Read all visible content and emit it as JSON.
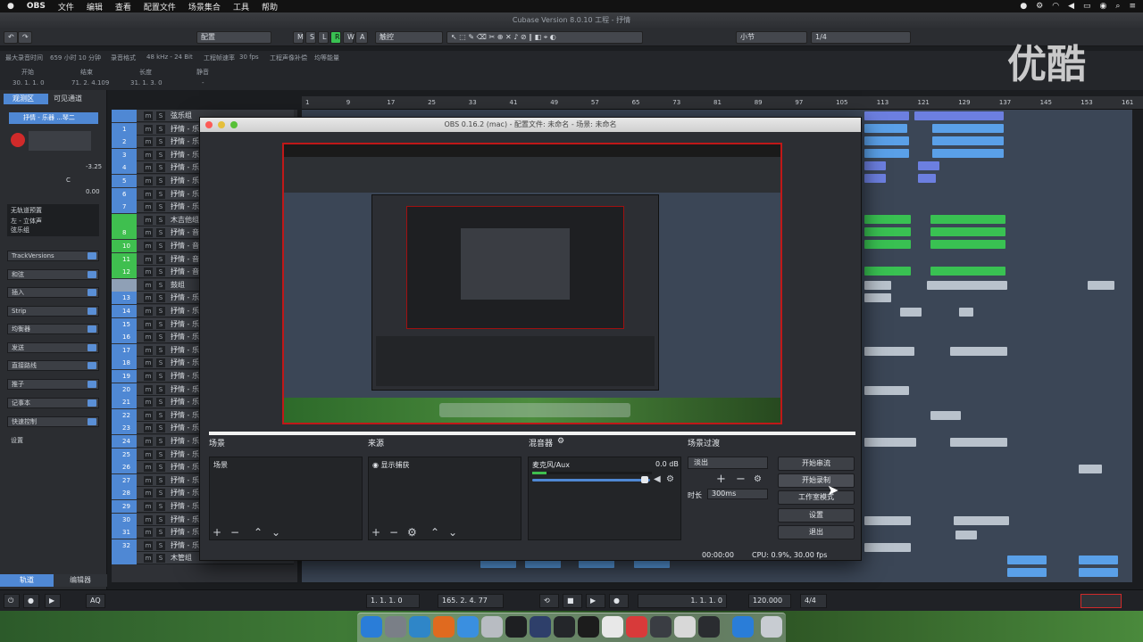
{
  "menubar": {
    "app": "OBS",
    "items": [
      "文件",
      "编辑",
      "查看",
      "配置文件",
      "场景集合",
      "工具",
      "帮助"
    ]
  },
  "cubase": {
    "title": "Cubase Version 8.0.10 工程 - 抒情",
    "toolbar": {
      "preset": "配置",
      "m": "M",
      "s": "S",
      "l": "L",
      "r": "R",
      "w": "W",
      "a": "A",
      "snap": "触控",
      "quant": "小节",
      "ratio": "1/4"
    },
    "info": [
      "最大录音时间",
      "659 小时 10 分钟",
      "录音格式",
      "48 kHz - 24 Bit",
      "工程帧速率",
      "30 fps",
      "工程声像补偿",
      "均等能量"
    ],
    "ruler_labels": [
      "开始",
      "结束",
      "长度",
      "静音"
    ],
    "ruler_values": [
      "30. 1. 1. 0",
      "71. 2. 4.109",
      "31. 1. 3. 0",
      "-"
    ]
  },
  "inspector": {
    "tabs": [
      "观测区",
      "可见通道"
    ],
    "track_name": "抒情 - 乐器 ...琴二",
    "level": "-3.25",
    "pan": "C",
    "gain": "0.00",
    "routing": [
      "无轨道预置",
      "左 - 立体声",
      "弦乐组"
    ],
    "sections": [
      "TrackVersions",
      "和弦",
      "插入",
      "Strip",
      "均衡器",
      "发送",
      "直接路线",
      "推子",
      "记事本",
      "快速控制",
      "设置"
    ]
  },
  "tracks": [
    {
      "no": "",
      "name": "弦乐组",
      "color": "#4f88d4"
    },
    {
      "no": "1",
      "name": "抒情 - 乐",
      "color": "#4f88d4"
    },
    {
      "no": "2",
      "name": "抒情 - 乐",
      "color": "#4f88d4"
    },
    {
      "no": "3",
      "name": "抒情 - 乐",
      "color": "#4f88d4"
    },
    {
      "no": "4",
      "name": "抒情 - 乐",
      "color": "#4f88d4"
    },
    {
      "no": "5",
      "name": "抒情 - 乐",
      "color": "#4f88d4"
    },
    {
      "no": "6",
      "name": "抒情 - 乐",
      "color": "#4f88d4"
    },
    {
      "no": "7",
      "name": "抒情 - 乐",
      "color": "#4f88d4"
    },
    {
      "no": "",
      "name": "木吉他组",
      "color": "#3fbf4f"
    },
    {
      "no": "8",
      "name": "抒情 - 音",
      "color": "#3fbf4f"
    },
    {
      "no": "10",
      "name": "抒情 - 音",
      "color": "#3fbf4f"
    },
    {
      "no": "11",
      "name": "抒情 - 音",
      "color": "#3fbf4f"
    },
    {
      "no": "12",
      "name": "抒情 - 音",
      "color": "#3fbf4f"
    },
    {
      "no": "",
      "name": "鼓组",
      "color": "#8fa0b6"
    },
    {
      "no": "13",
      "name": "抒情 - 乐",
      "color": "#4f88d4"
    },
    {
      "no": "14",
      "name": "抒情 - 乐",
      "color": "#4f88d4"
    },
    {
      "no": "15",
      "name": "抒情 - 乐",
      "color": "#4f88d4"
    },
    {
      "no": "16",
      "name": "抒情 - 乐",
      "color": "#4f88d4"
    },
    {
      "no": "17",
      "name": "抒情 - 乐",
      "color": "#4f88d4"
    },
    {
      "no": "18",
      "name": "抒情 - 乐",
      "color": "#4f88d4"
    },
    {
      "no": "19",
      "name": "抒情 - 乐",
      "color": "#4f88d4"
    },
    {
      "no": "20",
      "name": "抒情 - 乐",
      "color": "#4f88d4"
    },
    {
      "no": "21",
      "name": "抒情 - 乐",
      "color": "#4f88d4"
    },
    {
      "no": "22",
      "name": "抒情 - 乐",
      "color": "#4f88d4"
    },
    {
      "no": "23",
      "name": "抒情 - 乐",
      "color": "#4f88d4"
    },
    {
      "no": "24",
      "name": "抒情 - 乐",
      "color": "#4f88d4"
    },
    {
      "no": "25",
      "name": "抒情 - 乐",
      "color": "#4f88d4"
    },
    {
      "no": "26",
      "name": "抒情 - 乐",
      "color": "#4f88d4"
    },
    {
      "no": "27",
      "name": "抒情 - 乐",
      "color": "#4f88d4"
    },
    {
      "no": "28",
      "name": "抒情 - 乐",
      "color": "#4f88d4"
    },
    {
      "no": "29",
      "name": "抒情 - 乐",
      "color": "#4f88d4"
    },
    {
      "no": "30",
      "name": "抒情 - 乐",
      "color": "#4f88d4"
    },
    {
      "no": "31",
      "name": "抒情 - 乐",
      "color": "#4f88d4"
    },
    {
      "no": "32",
      "name": "抒情 - 乐",
      "color": "#4f88d4"
    },
    {
      "no": "",
      "name": "木管组",
      "color": "#4f88d4"
    }
  ],
  "bottom_tabs": [
    "轨道",
    "编辑器"
  ],
  "ruler_ticks": [
    "1",
    "9",
    "17",
    "25",
    "33",
    "41",
    "49",
    "57",
    "65",
    "73",
    "81",
    "89",
    "97",
    "105",
    "113",
    "121",
    "129",
    "137",
    "145",
    "153",
    "161"
  ],
  "obs": {
    "title": "OBS 0.16.2 (mac) - 配置文件: 未命名 - 场景: 未命名",
    "panels": {
      "scenes": {
        "header": "场景",
        "items": [
          "场景"
        ]
      },
      "sources": {
        "header": "来源",
        "items": [
          "显示捕获"
        ]
      },
      "mixer": {
        "header": "混音器",
        "channel": "麦克风/Aux",
        "level": "0.0 dB"
      },
      "transitions": {
        "header": "场景过渡",
        "type": "淡出",
        "duration_label": "时长",
        "duration": "300ms"
      }
    },
    "controls": {
      "start_stream": "开始串流",
      "start_record": "开始录制",
      "studio_mode": "工作室模式",
      "settings": "设置",
      "exit": "退出"
    },
    "status": {
      "time": "00:00:00",
      "cpu": "CPU: 0.9%, 30.00 fps"
    }
  },
  "transport": {
    "left_loc": "1. 1. 1. 0",
    "right_loc": "165. 2. 4. 77",
    "position": "1. 1. 1. 0",
    "tempo": "120.000",
    "signature": "4/4"
  },
  "watermark": "优酷",
  "accent": "#4f88d4"
}
